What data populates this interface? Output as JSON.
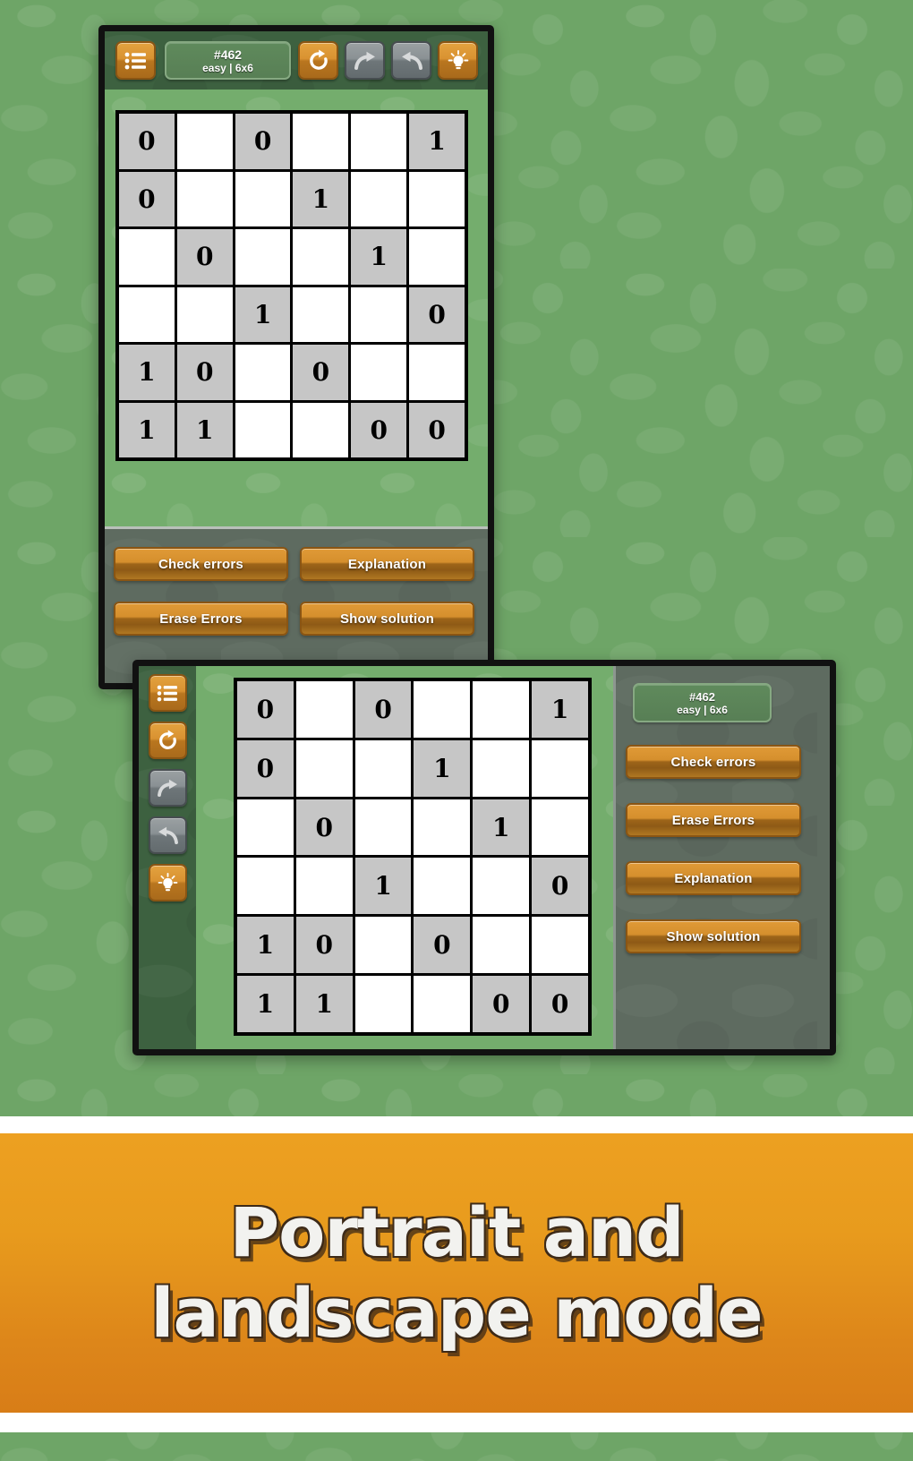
{
  "background": {
    "color": "#6ea567"
  },
  "puzzle": {
    "id": "#462",
    "meta": "easy | 6x6",
    "rows": 6,
    "cols": 6,
    "cells": [
      [
        {
          "v": "0",
          "given": true
        },
        {
          "v": "",
          "given": false
        },
        {
          "v": "0",
          "given": true
        },
        {
          "v": "",
          "given": false
        },
        {
          "v": "",
          "given": false
        },
        {
          "v": "1",
          "given": true
        }
      ],
      [
        {
          "v": "0",
          "given": true
        },
        {
          "v": "",
          "given": false
        },
        {
          "v": "",
          "given": false
        },
        {
          "v": "1",
          "given": true
        },
        {
          "v": "",
          "given": false
        },
        {
          "v": "",
          "given": false
        }
      ],
      [
        {
          "v": "",
          "given": false
        },
        {
          "v": "0",
          "given": true
        },
        {
          "v": "",
          "given": false
        },
        {
          "v": "",
          "given": false
        },
        {
          "v": "1",
          "given": true
        },
        {
          "v": "",
          "given": false
        }
      ],
      [
        {
          "v": "",
          "given": false
        },
        {
          "v": "",
          "given": false
        },
        {
          "v": "1",
          "given": true
        },
        {
          "v": "",
          "given": false
        },
        {
          "v": "",
          "given": false
        },
        {
          "v": "0",
          "given": true
        }
      ],
      [
        {
          "v": "1",
          "given": true
        },
        {
          "v": "0",
          "given": true
        },
        {
          "v": "",
          "given": false
        },
        {
          "v": "0",
          "given": true
        },
        {
          "v": "",
          "given": false
        },
        {
          "v": "",
          "given": false
        }
      ],
      [
        {
          "v": "1",
          "given": true
        },
        {
          "v": "1",
          "given": true
        },
        {
          "v": "",
          "given": false
        },
        {
          "v": "",
          "given": false
        },
        {
          "v": "0",
          "given": true
        },
        {
          "v": "0",
          "given": true
        }
      ]
    ]
  },
  "portrait": {
    "toolbar": {
      "menu": "menu-list-icon",
      "restart": "restart-circular-arrow-icon",
      "redo": "redo-arrow-icon",
      "undo": "undo-arrow-icon",
      "hint": "lightbulb-hint-icon"
    },
    "actions": [
      {
        "label": "Check errors",
        "name": "check-errors-button"
      },
      {
        "label": "Explanation",
        "name": "explanation-button"
      },
      {
        "label": "Erase Errors",
        "name": "erase-errors-button"
      },
      {
        "label": "Show solution",
        "name": "show-solution-button"
      }
    ]
  },
  "landscape": {
    "toolbar": {
      "menu": "menu-list-icon",
      "restart": "restart-circular-arrow-icon",
      "redo": "redo-arrow-icon",
      "undo": "undo-arrow-icon",
      "hint": "lightbulb-hint-icon"
    },
    "actions": [
      {
        "label": "Check errors",
        "name": "check-errors-button"
      },
      {
        "label": "Erase Errors",
        "name": "erase-errors-button"
      },
      {
        "label": "Explanation",
        "name": "explanation-button"
      },
      {
        "label": "Show solution",
        "name": "show-solution-button"
      }
    ]
  },
  "banner": {
    "line1": "Portrait and",
    "line2": "landscape mode",
    "bg_color": "#e89b1d",
    "text_color": "#f2f2ef"
  },
  "colors": {
    "accent_orange": "#d99231",
    "felt_green": "#3d6140",
    "panel_grey": "#5e6b60",
    "board_green": "#74ad6d",
    "given_cell": "#c6c6c6",
    "empty_cell": "#ffffff"
  }
}
